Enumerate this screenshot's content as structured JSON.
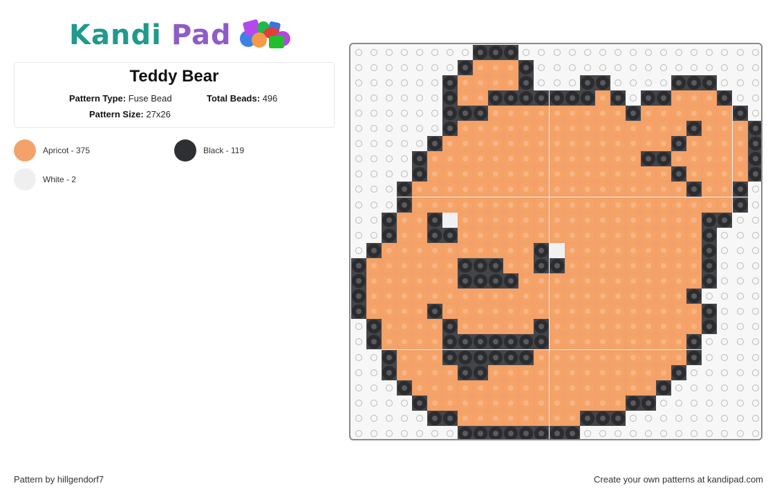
{
  "header": {
    "logo_part1": "Kandi",
    "logo_part2": "Pad",
    "logo_icon": "bead-pile-icon"
  },
  "pattern": {
    "title": "Teddy Bear",
    "type_label": "Pattern Type:",
    "type_value": "Fuse Bead",
    "total_label": "Total Beads:",
    "total_value": "496",
    "size_label": "Pattern Size:",
    "size_value": "27x26"
  },
  "legend": [
    {
      "key": "A",
      "name": "Apricot",
      "count": 375,
      "label": "Apricot - 375",
      "color": "#f4a26b"
    },
    {
      "key": "B",
      "name": "Black",
      "count": 119,
      "label": "Black - 119",
      "color": "#2e2f33"
    },
    {
      "key": "W",
      "name": "White",
      "count": 2,
      "label": "White - 2",
      "color": "#efefef"
    }
  ],
  "grid": {
    "columns": 27,
    "rows": 26,
    "legend_key": {
      ".": "empty",
      "A": "Apricot",
      "B": "Black",
      "W": "White"
    },
    "cells": [
      "........BBB................",
      ".......BAAAB...............",
      "......BAAAAB...BB....BBB...",
      "......BAABBBBBBBAB.BBAAAB..",
      "......BBBAAAAAAAAABAAAAAAB.",
      "......BAAAAAAAAAAAAAAABAAAB",
      ".....BAAAAAAAAAAAAAAABAAAAB",
      "....BAAAAAAAAAAAAAABBAAAAAB",
      "....BAAAAAAAAAAAAAAAABAAAAB",
      "...BAAAAAAAAAAAAAAAAAABAAB.",
      "...BAAAAAAAAAAAAAAAAAAAAAB.",
      "..BAABWAAAAAAAAAAAAAAAABB..",
      "..BAABBAAAAAAAAAAAAAAAAB...",
      ".BAAAAAAAAAABWAAAAAAAAAB...",
      "BAAAAAABBBAABBAAAAAAAAAB...",
      "BAAAAAABBBBAAAAAAAAAAAAB...",
      "BAAAAAAAAAAAAAAAAAAAAAB....",
      "BAAAABAAAAAAAAAAAAAAAAAB...",
      ".BAAAABAAAAABAAAAAAAAAAB...",
      ".BAAAABBBBBBBAAAAAAAAAB....",
      "..BAAABBBBBBAAAAAAAAAAB....",
      "..BAAAABBAAAAAAAAAAAAB.....",
      "...BAAAAAAAAAAAAAAAAB......",
      "....BAAAAAAAAAAAAABB.......",
      ".....BBAAAAAAAABBB.........",
      ".......BBBBBBBB............"
    ]
  },
  "footer": {
    "credit": "Pattern by hillgendorf7",
    "promo": "Create your own patterns at kandipad.com"
  }
}
